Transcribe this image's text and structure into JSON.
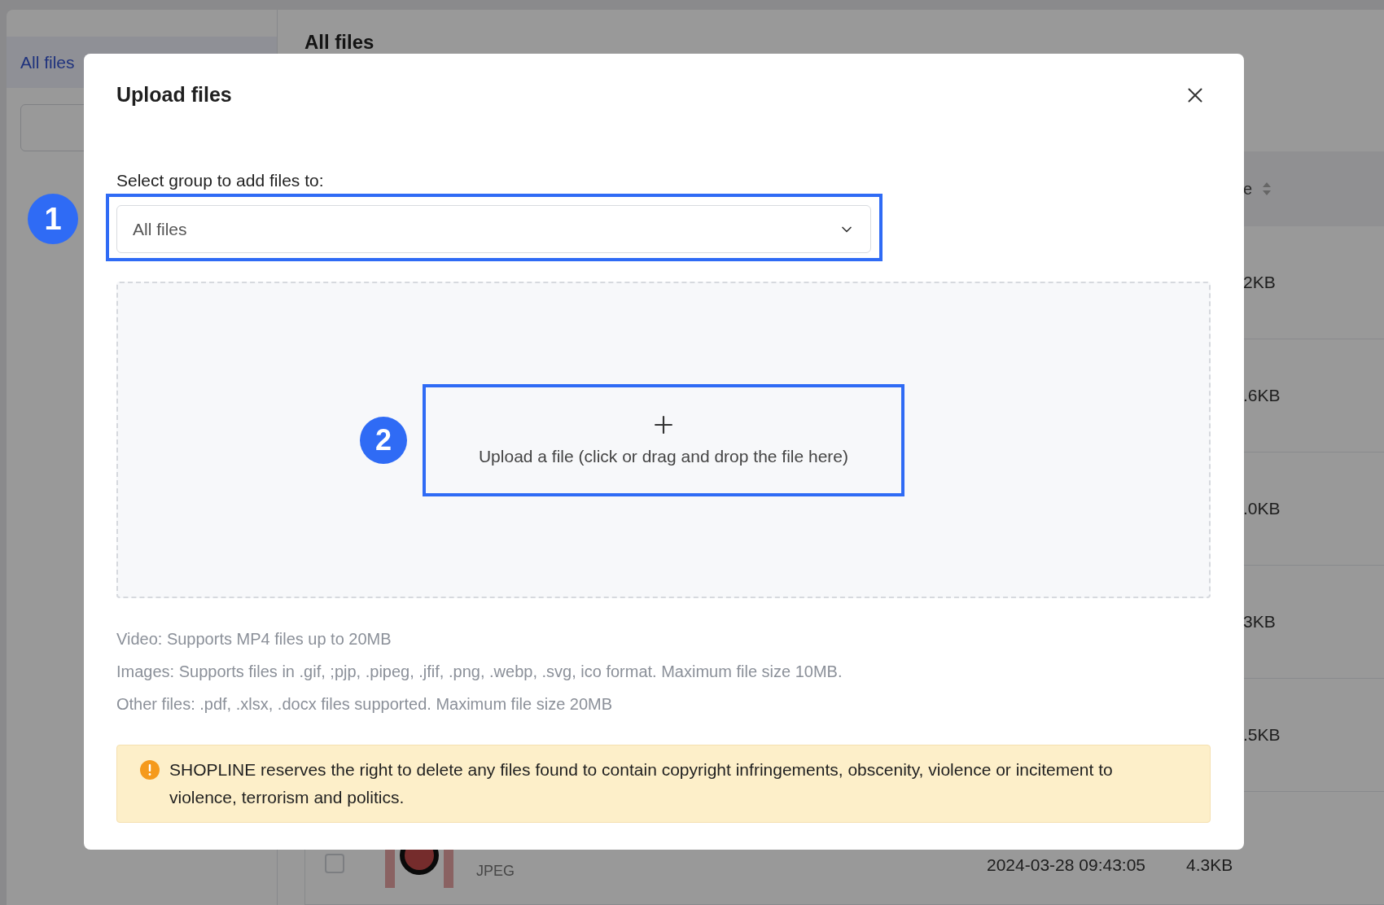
{
  "background": {
    "sidebar": {
      "tab": "All files"
    },
    "heading": "All files",
    "table": {
      "size_header": "e",
      "rows": [
        {
          "size": "2KB"
        },
        {
          "size": ".6KB"
        },
        {
          "size": ".0KB"
        },
        {
          "size": "3KB"
        },
        {
          "size": ".5KB"
        },
        {
          "checked": false,
          "type": "JPEG",
          "date": "2024-03-28 09:43:05",
          "size": "4.3KB"
        }
      ]
    }
  },
  "dialog": {
    "title": "Upload files",
    "group_label": "Select group to add files to:",
    "group_select": {
      "value": "All files"
    },
    "dropzone": {
      "text": "Upload a file (click or drag and drop the file here)"
    },
    "info": [
      "Video: Supports MP4 files up to 20MB",
      "Images: Supports files in .gif, ;pjp, .pipeg, .jfif, .png, .webp, .svg, ico format. Maximum file size 10MB.",
      "Other files: .pdf, .xlsx, .docx files supported. Maximum file size 20MB"
    ],
    "warning": "SHOPLINE reserves the right to delete any files found to contain copyright infringements, obscenity, violence or incitement to violence, terrorism and politics."
  },
  "annotations": [
    {
      "label": "1"
    },
    {
      "label": "2"
    }
  ]
}
